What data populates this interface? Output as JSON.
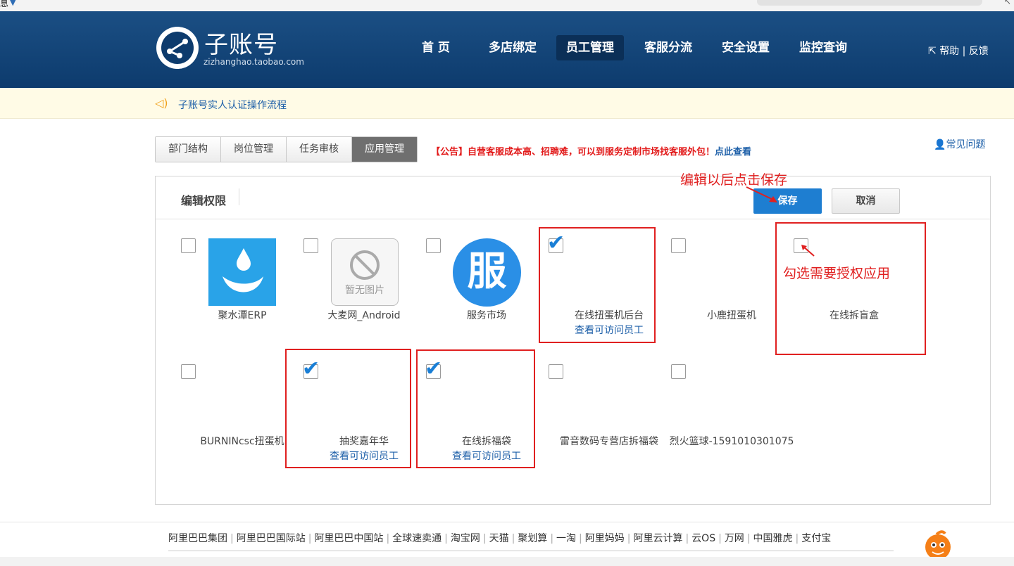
{
  "topstrip": {
    "text": "息"
  },
  "header": {
    "logo_title": "子账号",
    "logo_url": "zizhanghao.taobao.com",
    "nav": [
      {
        "label": "首 页"
      },
      {
        "label": "多店绑定"
      },
      {
        "label": "员工管理"
      },
      {
        "label": "客服分流"
      },
      {
        "label": "安全设置"
      },
      {
        "label": "监控查询"
      }
    ],
    "help": "帮助",
    "feedback": "反馈",
    "help_sep": "|"
  },
  "notice": {
    "text": "子账号实人认证操作流程"
  },
  "tabs": [
    {
      "label": "部门结构"
    },
    {
      "label": "岗位管理"
    },
    {
      "label": "任务审核"
    },
    {
      "label": "应用管理"
    }
  ],
  "announce": {
    "text": "【公告】自营客服成本高、招聘难，可以到服务定制市场找客服外包！",
    "link": "点此查看"
  },
  "faq": {
    "label": "常见问题"
  },
  "panel": {
    "title": "编辑权限",
    "save": "保存",
    "cancel": "取消",
    "view_staff": "查看可访问员工",
    "noimg_text": "暂无图片",
    "fw_glyph": "服",
    "apps": [
      {
        "name": "聚水潭ERP",
        "checked": false,
        "icon": "water-drop-icon"
      },
      {
        "name": "大麦网_Android",
        "checked": false,
        "icon": "no-image-icon"
      },
      {
        "name": "服务市场",
        "checked": false,
        "icon": "fu-logo-icon"
      },
      {
        "name": "在线扭蛋机后台",
        "checked": true
      },
      {
        "name": "小鹿扭蛋机",
        "checked": false
      },
      {
        "name": "在线拆盲盒",
        "checked": false
      },
      {
        "name": "BURNINcsc扭蛋机",
        "checked": false
      },
      {
        "name": "抽奖嘉年华",
        "checked": true
      },
      {
        "name": "在线拆福袋",
        "checked": true
      },
      {
        "name": "雷音数码专营店拆福袋",
        "checked": false
      },
      {
        "name": "烈火篮球-1591010301075",
        "checked": false
      }
    ]
  },
  "annotations": {
    "save_hint": "编辑以后点击保存",
    "check_hint": "勾选需要授权应用"
  },
  "footer": {
    "links": [
      "阿里巴巴集团",
      "阿里巴巴国际站",
      "阿里巴巴中国站",
      "全球速卖通",
      "淘宝网",
      "天猫",
      "聚划算",
      "一淘",
      "阿里妈妈",
      "阿里云计算",
      "云OS",
      "万网",
      "中国雅虎",
      "支付宝"
    ]
  },
  "colors": {
    "header": "#0d3b6d",
    "link": "#1d5fa8",
    "accent": "#1e7ed1",
    "annotation": "#e02020"
  }
}
